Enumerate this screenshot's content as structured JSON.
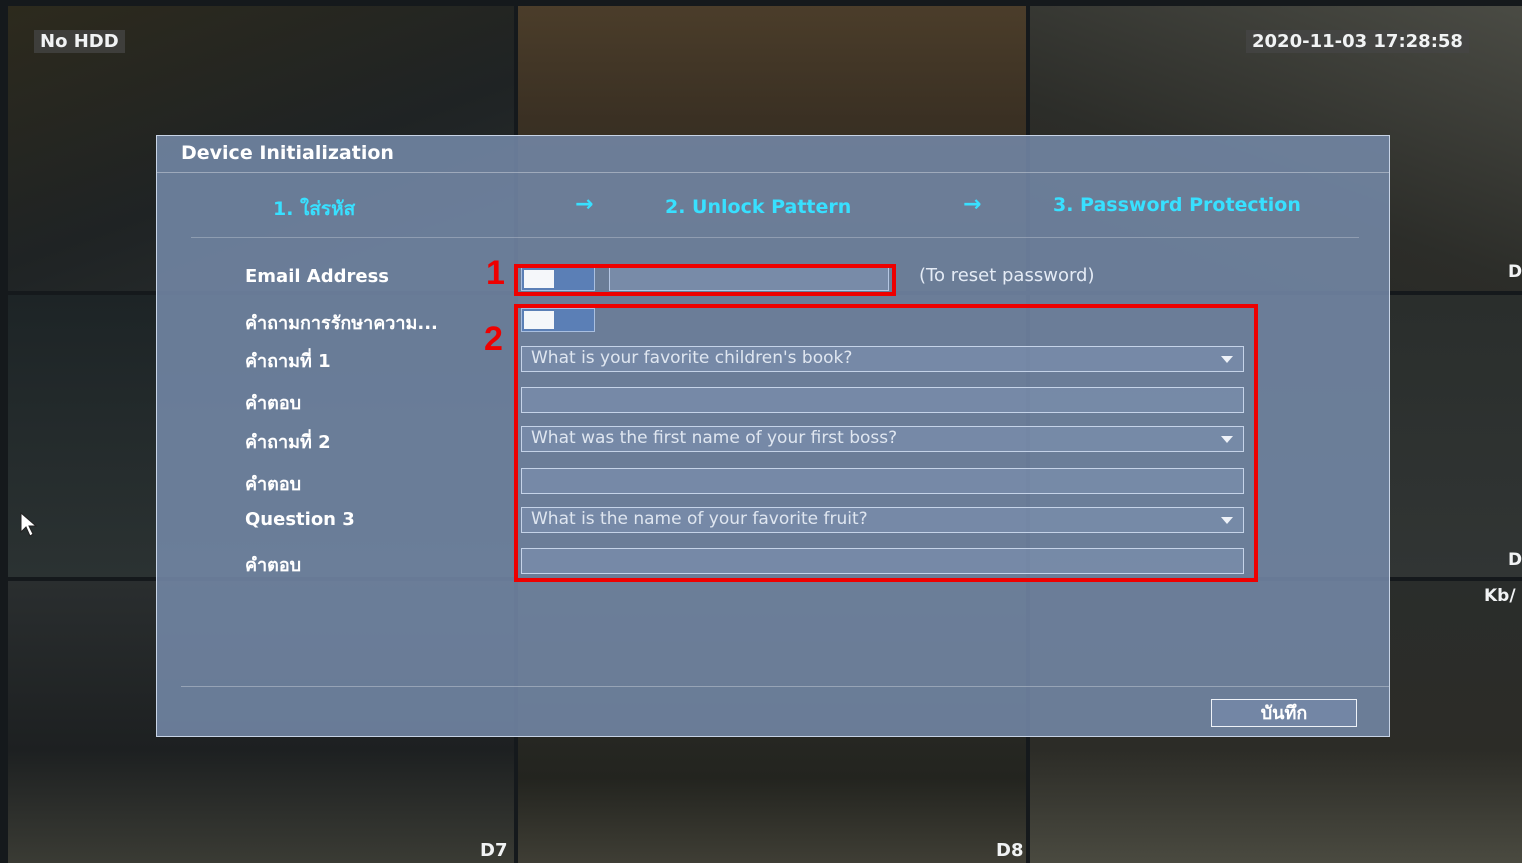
{
  "osd": {
    "hdd_status": "No HDD",
    "datetime": "2020-11-03 17:28:58",
    "channel_d7": "D7",
    "channel_d8": "D8",
    "edge_d_top": "D",
    "edge_d_mid": "D",
    "edge_rate": "Kb/"
  },
  "dialog": {
    "title": "Device Initialization",
    "steps": [
      {
        "label": "1.  ใส่รหัส"
      },
      {
        "label": "2.  Unlock Pattern"
      },
      {
        "label": "3.  Password Protection"
      }
    ],
    "arrow": "→",
    "labels": {
      "email": "Email Address",
      "security_question": "คำถามการรักษาความ...",
      "q1": "คำถามที่ 1",
      "a1": "คำตอบ",
      "q2": "คำถามที่ 2",
      "a2": "คำตอบ",
      "q3": "Question 3",
      "a3": "คำตอบ"
    },
    "email_hint": "(To reset password)",
    "email_value": "",
    "questions": {
      "q1": "What is your favorite children's book?",
      "q2": "What was the first name of your first boss?",
      "q3": "What is the name of your favorite fruit?"
    },
    "answers": {
      "a1": "",
      "a2": "",
      "a3": ""
    },
    "email_toggle_on": false,
    "security_toggle_on": false,
    "save_label": "บันทึก"
  },
  "annotations": {
    "marker_1": "1",
    "marker_2": "2",
    "color": "#ee0000"
  },
  "colors": {
    "accent": "#38e0ff",
    "dialog_bg": "#768aaa"
  }
}
